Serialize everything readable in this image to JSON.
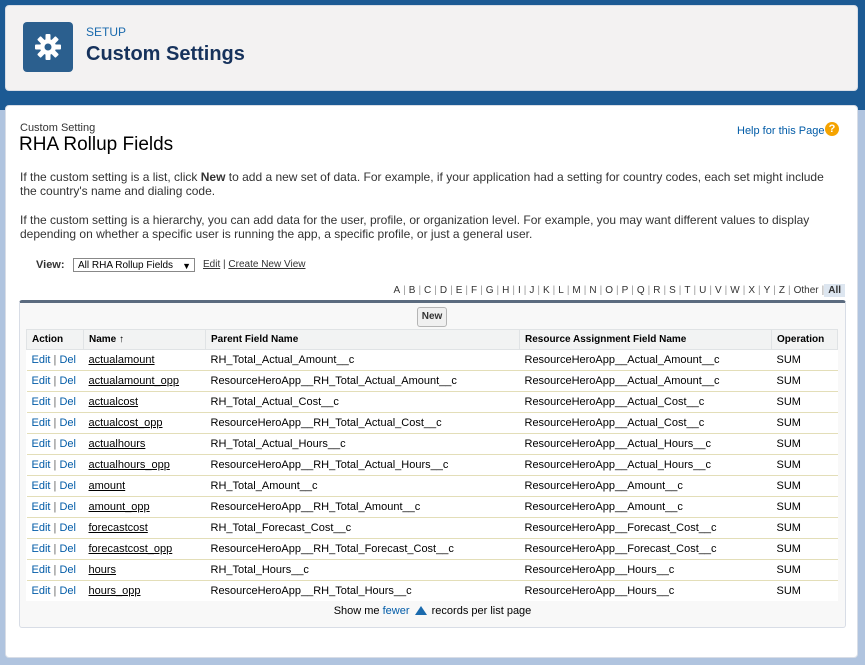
{
  "header": {
    "eyebrow": "SETUP",
    "title": "Custom Settings"
  },
  "page": {
    "eyebrow": "Custom Setting",
    "title": "RHA Rollup Fields",
    "help_link": "Help for this Page",
    "desc1_pre": "If the custom setting is a list, click ",
    "desc1_bold": "New",
    "desc1_post": " to add a new set of data. For example, if your application had a setting for country codes, each set might include the country's name and dialing code.",
    "desc2": "If the custom setting is a hierarchy, you can add data for the user, profile, or organization level. For example, you may want different values to display depending on whether a specific user is running the app, a specific profile, or just a general user."
  },
  "view": {
    "label": "View:",
    "selected": "All RHA Rollup Fields",
    "edit": "Edit",
    "sep": "|",
    "create": "Create New View"
  },
  "alpha": [
    "A",
    "B",
    "C",
    "D",
    "E",
    "F",
    "G",
    "H",
    "I",
    "J",
    "K",
    "L",
    "M",
    "N",
    "O",
    "P",
    "Q",
    "R",
    "S",
    "T",
    "U",
    "V",
    "W",
    "X",
    "Y",
    "Z",
    "Other",
    "All"
  ],
  "list": {
    "new_button": "New",
    "columns": [
      "Action",
      "Name",
      "Parent Field Name",
      "Resource Assignment Field Name",
      "Operation"
    ],
    "sort_indicator": "↑",
    "edit_label": "Edit",
    "del_label": "Del",
    "action_sep": "|",
    "rows": [
      {
        "name": "actualamount",
        "parent": "RH_Total_Actual_Amount__c",
        "resource": "ResourceHeroApp__Actual_Amount__c",
        "op": "SUM"
      },
      {
        "name": "actualamount_opp",
        "parent": "ResourceHeroApp__RH_Total_Actual_Amount__c",
        "resource": "ResourceHeroApp__Actual_Amount__c",
        "op": "SUM"
      },
      {
        "name": "actualcost",
        "parent": "RH_Total_Actual_Cost__c",
        "resource": "ResourceHeroApp__Actual_Cost__c",
        "op": "SUM"
      },
      {
        "name": "actualcost_opp",
        "parent": "ResourceHeroApp__RH_Total_Actual_Cost__c",
        "resource": "ResourceHeroApp__Actual_Cost__c",
        "op": "SUM"
      },
      {
        "name": "actualhours",
        "parent": "RH_Total_Actual_Hours__c",
        "resource": "ResourceHeroApp__Actual_Hours__c",
        "op": "SUM"
      },
      {
        "name": "actualhours_opp",
        "parent": "ResourceHeroApp__RH_Total_Actual_Hours__c",
        "resource": "ResourceHeroApp__Actual_Hours__c",
        "op": "SUM"
      },
      {
        "name": "amount",
        "parent": "RH_Total_Amount__c",
        "resource": "ResourceHeroApp__Amount__c",
        "op": "SUM"
      },
      {
        "name": "amount_opp",
        "parent": "ResourceHeroApp__RH_Total_Amount__c",
        "resource": "ResourceHeroApp__Amount__c",
        "op": "SUM"
      },
      {
        "name": "forecastcost",
        "parent": "RH_Total_Forecast_Cost__c",
        "resource": "ResourceHeroApp__Forecast_Cost__c",
        "op": "SUM"
      },
      {
        "name": "forecastcost_opp",
        "parent": "ResourceHeroApp__RH_Total_Forecast_Cost__c",
        "resource": "ResourceHeroApp__Forecast_Cost__c",
        "op": "SUM"
      },
      {
        "name": "hours",
        "parent": "RH_Total_Hours__c",
        "resource": "ResourceHeroApp__Hours__c",
        "op": "SUM"
      },
      {
        "name": "hours_opp",
        "parent": "ResourceHeroApp__RH_Total_Hours__c",
        "resource": "ResourceHeroApp__Hours__c",
        "op": "SUM"
      }
    ]
  },
  "footer": {
    "pre": "Show me ",
    "link": "fewer",
    "post": " records per list page"
  }
}
